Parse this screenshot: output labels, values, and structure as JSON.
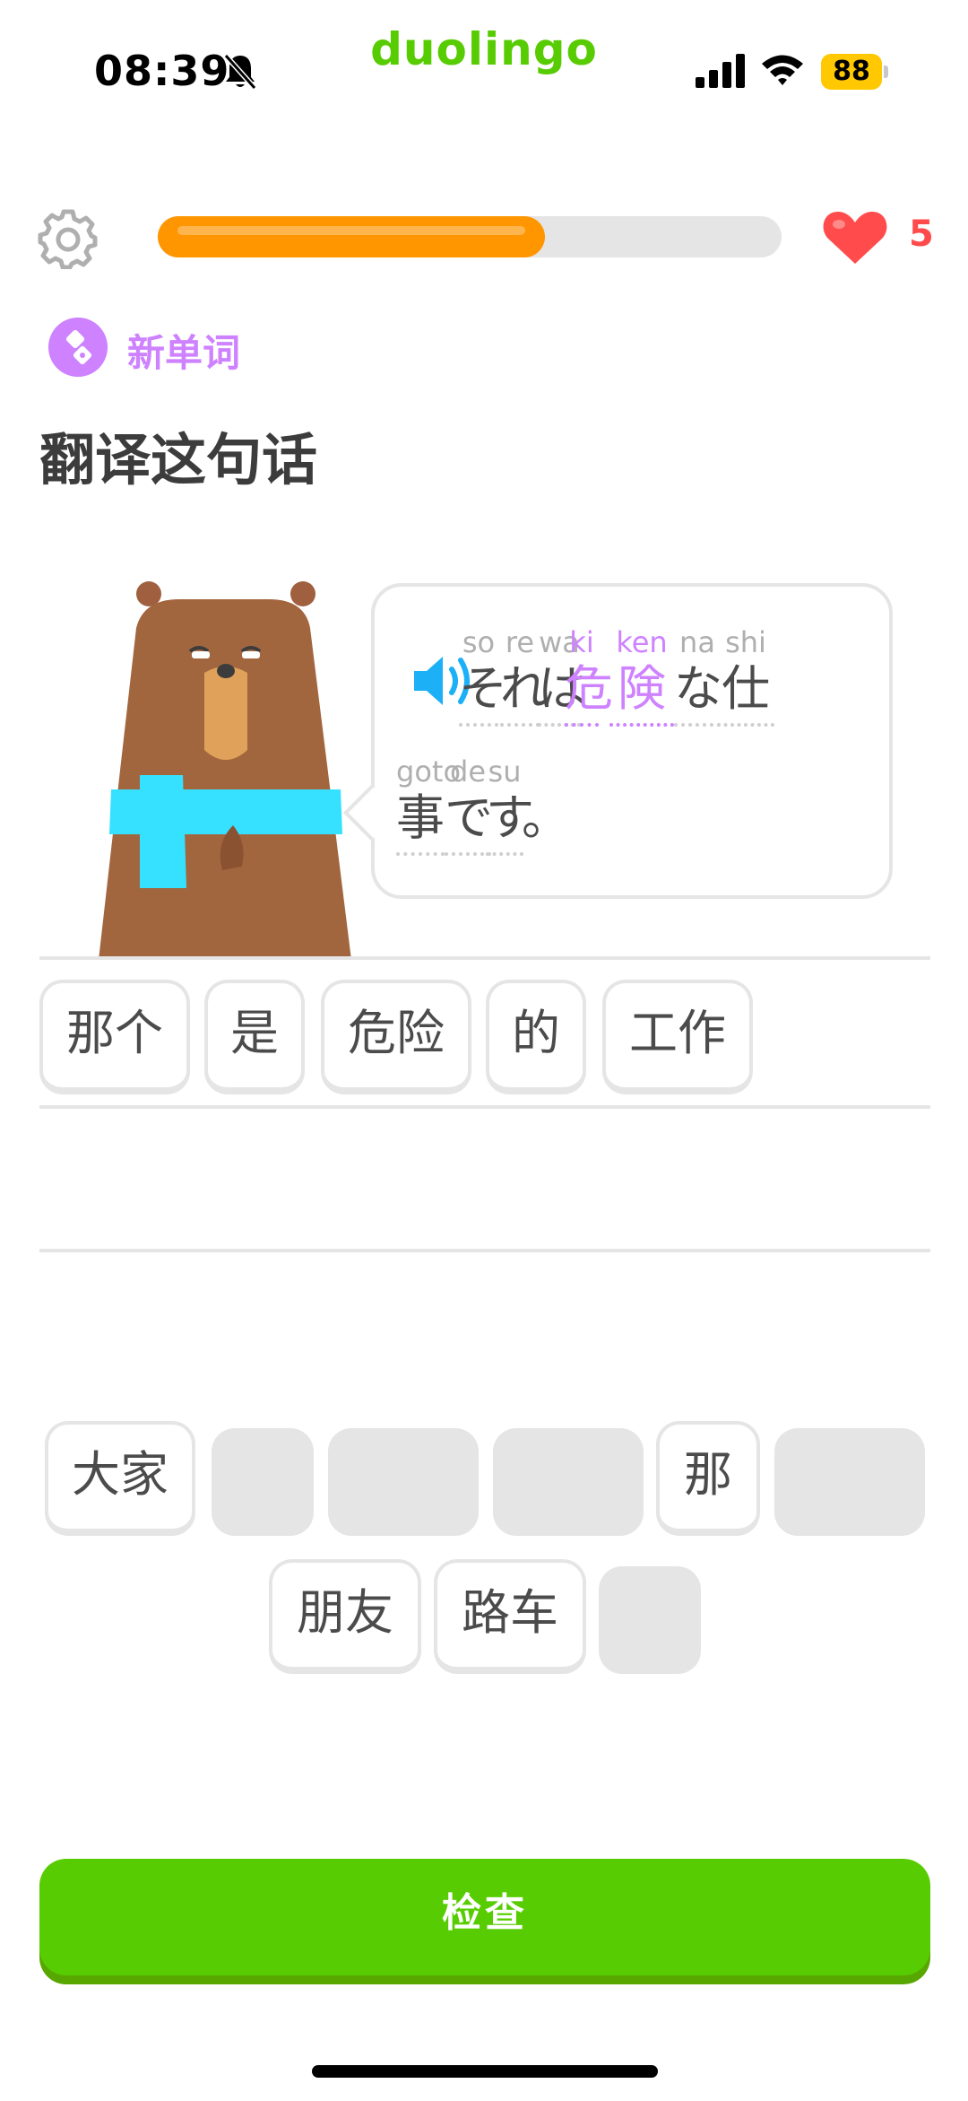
{
  "status_bar": {
    "time": "08:39",
    "brand": "duolingo",
    "battery": "88",
    "icons": [
      "bell-muted-icon",
      "cellular-signal-icon",
      "wifi-icon",
      "battery-icon"
    ]
  },
  "top_bar": {
    "settings_icon": "gear-icon",
    "progress_fraction": 0.62,
    "hearts": "5"
  },
  "challenge": {
    "badge_label": "新单词",
    "instruction": "翻译这句话"
  },
  "prompt": {
    "speaker_icon": "speaker-icon",
    "tokens": [
      {
        "rom": "so",
        "jp": "そ",
        "highlight": false
      },
      {
        "rom": "re",
        "jp": "れ",
        "highlight": false
      },
      {
        "rom": "wa",
        "jp": "は",
        "highlight": false
      },
      {
        "rom": "ki",
        "jp": "危",
        "highlight": true
      },
      {
        "rom": "ken",
        "jp": "険",
        "highlight": true
      },
      {
        "rom": "na",
        "jp": "な",
        "highlight": false
      },
      {
        "rom": "shi",
        "jp": "仕",
        "highlight": false
      },
      {
        "rom": "goto",
        "jp": "事",
        "highlight": false
      },
      {
        "rom": "de",
        "jp": "で",
        "highlight": false
      },
      {
        "rom": "su",
        "jp": "す",
        "highlight": false
      },
      {
        "rom": "",
        "jp": "。",
        "highlight": false
      }
    ]
  },
  "answer": {
    "selected": [
      "那个",
      "是",
      "危险",
      "的",
      "工作"
    ]
  },
  "word_bank": {
    "row1": [
      "大家",
      "",
      "",
      "",
      "那",
      ""
    ],
    "row2": [
      "朋友",
      "路车",
      ""
    ]
  },
  "colors": {
    "brand_green": "#58cc02",
    "progress_orange": "#ff9600",
    "heart_red": "#ff4b4b",
    "new_word_purple": "#ce82ff",
    "speaker_blue": "#1cb0f6"
  },
  "check_button": {
    "label": "检查"
  }
}
